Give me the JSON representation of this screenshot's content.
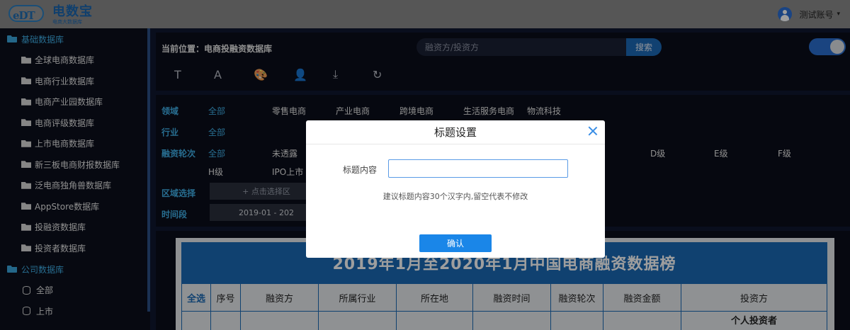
{
  "app": {
    "brand_name": "电数宝",
    "brand_sub": "电商大数据库",
    "logo_letters": "eDT"
  },
  "user": {
    "name": "测试账号",
    "caret": "▾"
  },
  "sidebar": {
    "groups": [
      {
        "label": "基础数据库",
        "items": [
          "全球电商数据库",
          "电商行业数据库",
          "电商产业园数据库",
          "电商评级数据库",
          "上市电商数据库",
          "新三板电商财报数据库",
          "泛电商独角兽数据库",
          "AppStore数据库",
          "投融资数据库",
          "投资者数据库"
        ]
      },
      {
        "label": "公司数据库",
        "items": [
          "全部",
          "上市"
        ]
      }
    ]
  },
  "header": {
    "breadcrumb": "当前位置：电商投融资数据库",
    "search_placeholder": "融资方/投资方",
    "search_button": "搜索",
    "tools": [
      "T",
      "A",
      "🎨",
      "👤",
      "⤓",
      "↻"
    ]
  },
  "filters": {
    "domain": {
      "label": "领域",
      "options": [
        "全部",
        "零售电商",
        "产业电商",
        "跨境电商",
        "生活服务电商",
        "物流科技"
      ]
    },
    "industry": {
      "label": "行业",
      "options": [
        "全部"
      ]
    },
    "round": {
      "label": "融资轮次",
      "options_row1": [
        "全部",
        "未透露"
      ],
      "options_right": [
        "D级",
        "E级",
        "F级"
      ],
      "options_row2": [
        "H级",
        "IPO上市"
      ]
    },
    "region": {
      "label": "区域选择",
      "box": "+ 点击选择区"
    },
    "period": {
      "label": "时间段",
      "box": "2019-01 - 202"
    }
  },
  "table": {
    "title": "2019年1月至2020年1月中国电商融资数据榜",
    "columns": [
      "全选",
      "序号",
      "融资方",
      "所属行业",
      "所在地",
      "融资时间",
      "融资轮次",
      "融资金额",
      "投资方"
    ],
    "first_row_investor": "个人投资者"
  },
  "modal": {
    "title": "标题设置",
    "field_label": "标题内容",
    "field_value": "",
    "hint": "建议标题内容30个汉字内,留空代表不修改",
    "confirm": "确认"
  }
}
